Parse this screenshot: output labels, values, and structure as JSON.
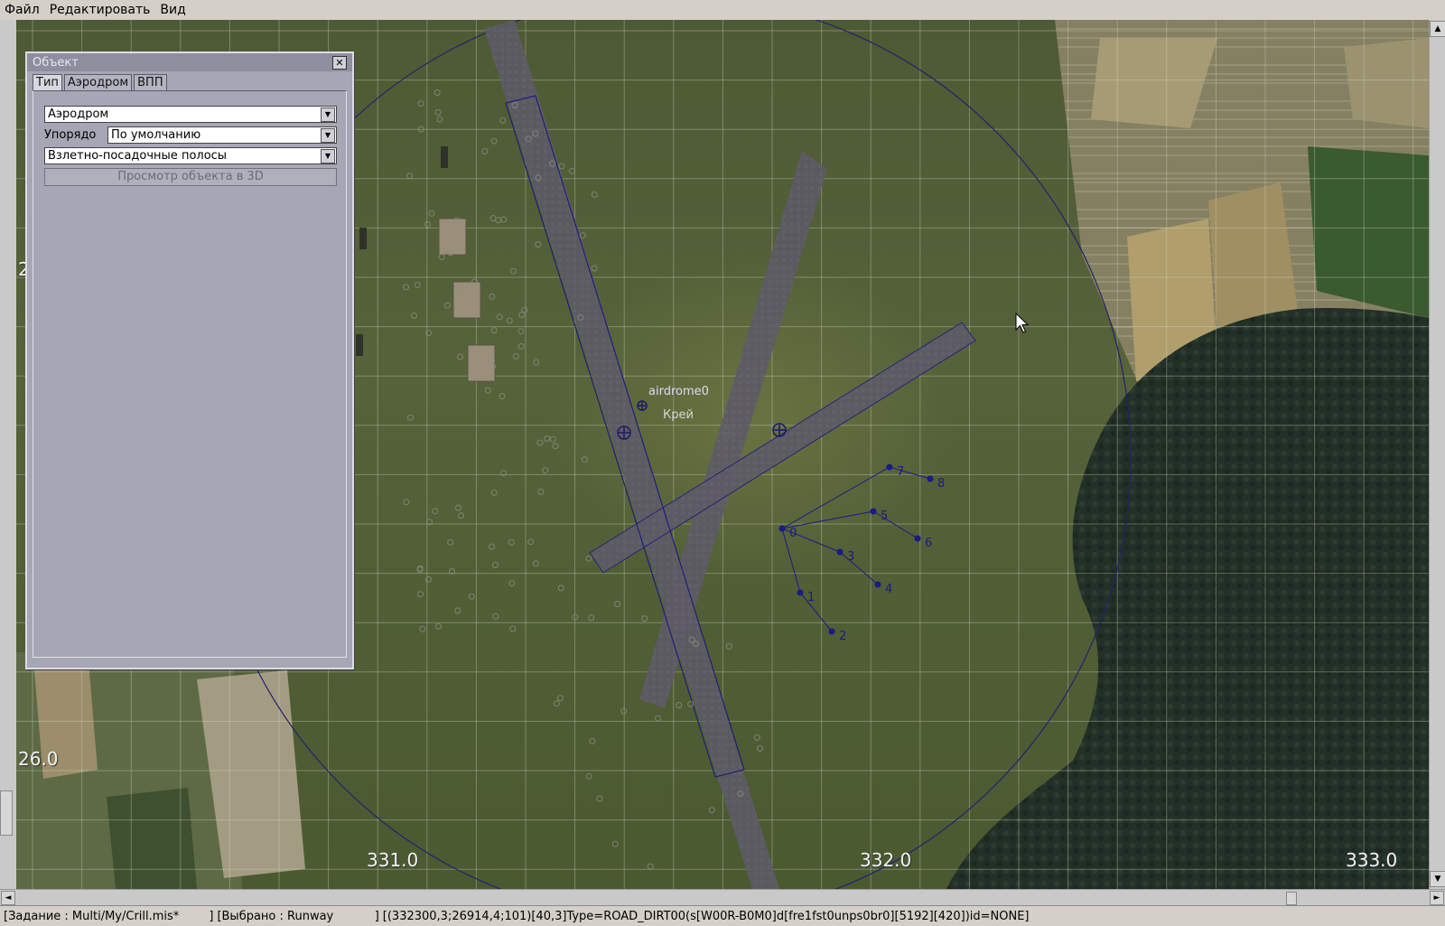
{
  "menubar": {
    "items": [
      "Файл",
      "Редактировать",
      "Вид"
    ]
  },
  "panel": {
    "title": "Объект",
    "close_glyph": "✕",
    "tabs": [
      "Тип",
      "Аэродром",
      "ВПП"
    ],
    "active_tab": "Тип",
    "type_value": "Аэродром",
    "order_label": "Упорядо",
    "order_value": "По умолчанию",
    "category_value": "Взлетно-посадочные полосы",
    "view_3d_button": "Просмотр объекта в 3D"
  },
  "map": {
    "grid_labels": {
      "x_331": "331.0",
      "x_332": "332.0",
      "x_333": "333.0",
      "y_26": "26.0",
      "y_27": "2"
    },
    "object_label": "airdrome0",
    "sub_label": "Крей",
    "waypoints": [
      "0",
      "1",
      "2",
      "3",
      "4",
      "5",
      "6",
      "7",
      "8"
    ]
  },
  "statusbar": {
    "mission": "[Задание : Multi/My/Crill.mis*        ]",
    "selected": "[Выбрано : Runway           ]",
    "details": "[(332300,3;26914,4;101)[40,3]Type=ROAD_DIRT00(s[W00R-B0M0]d[fre1fst0unps0br0][5192][420])id=NONE]"
  },
  "icons": {
    "scroll_left": "◄",
    "scroll_right": "►",
    "scroll_up": "▲",
    "scroll_down": "▼",
    "combo_arrow": "▼"
  }
}
